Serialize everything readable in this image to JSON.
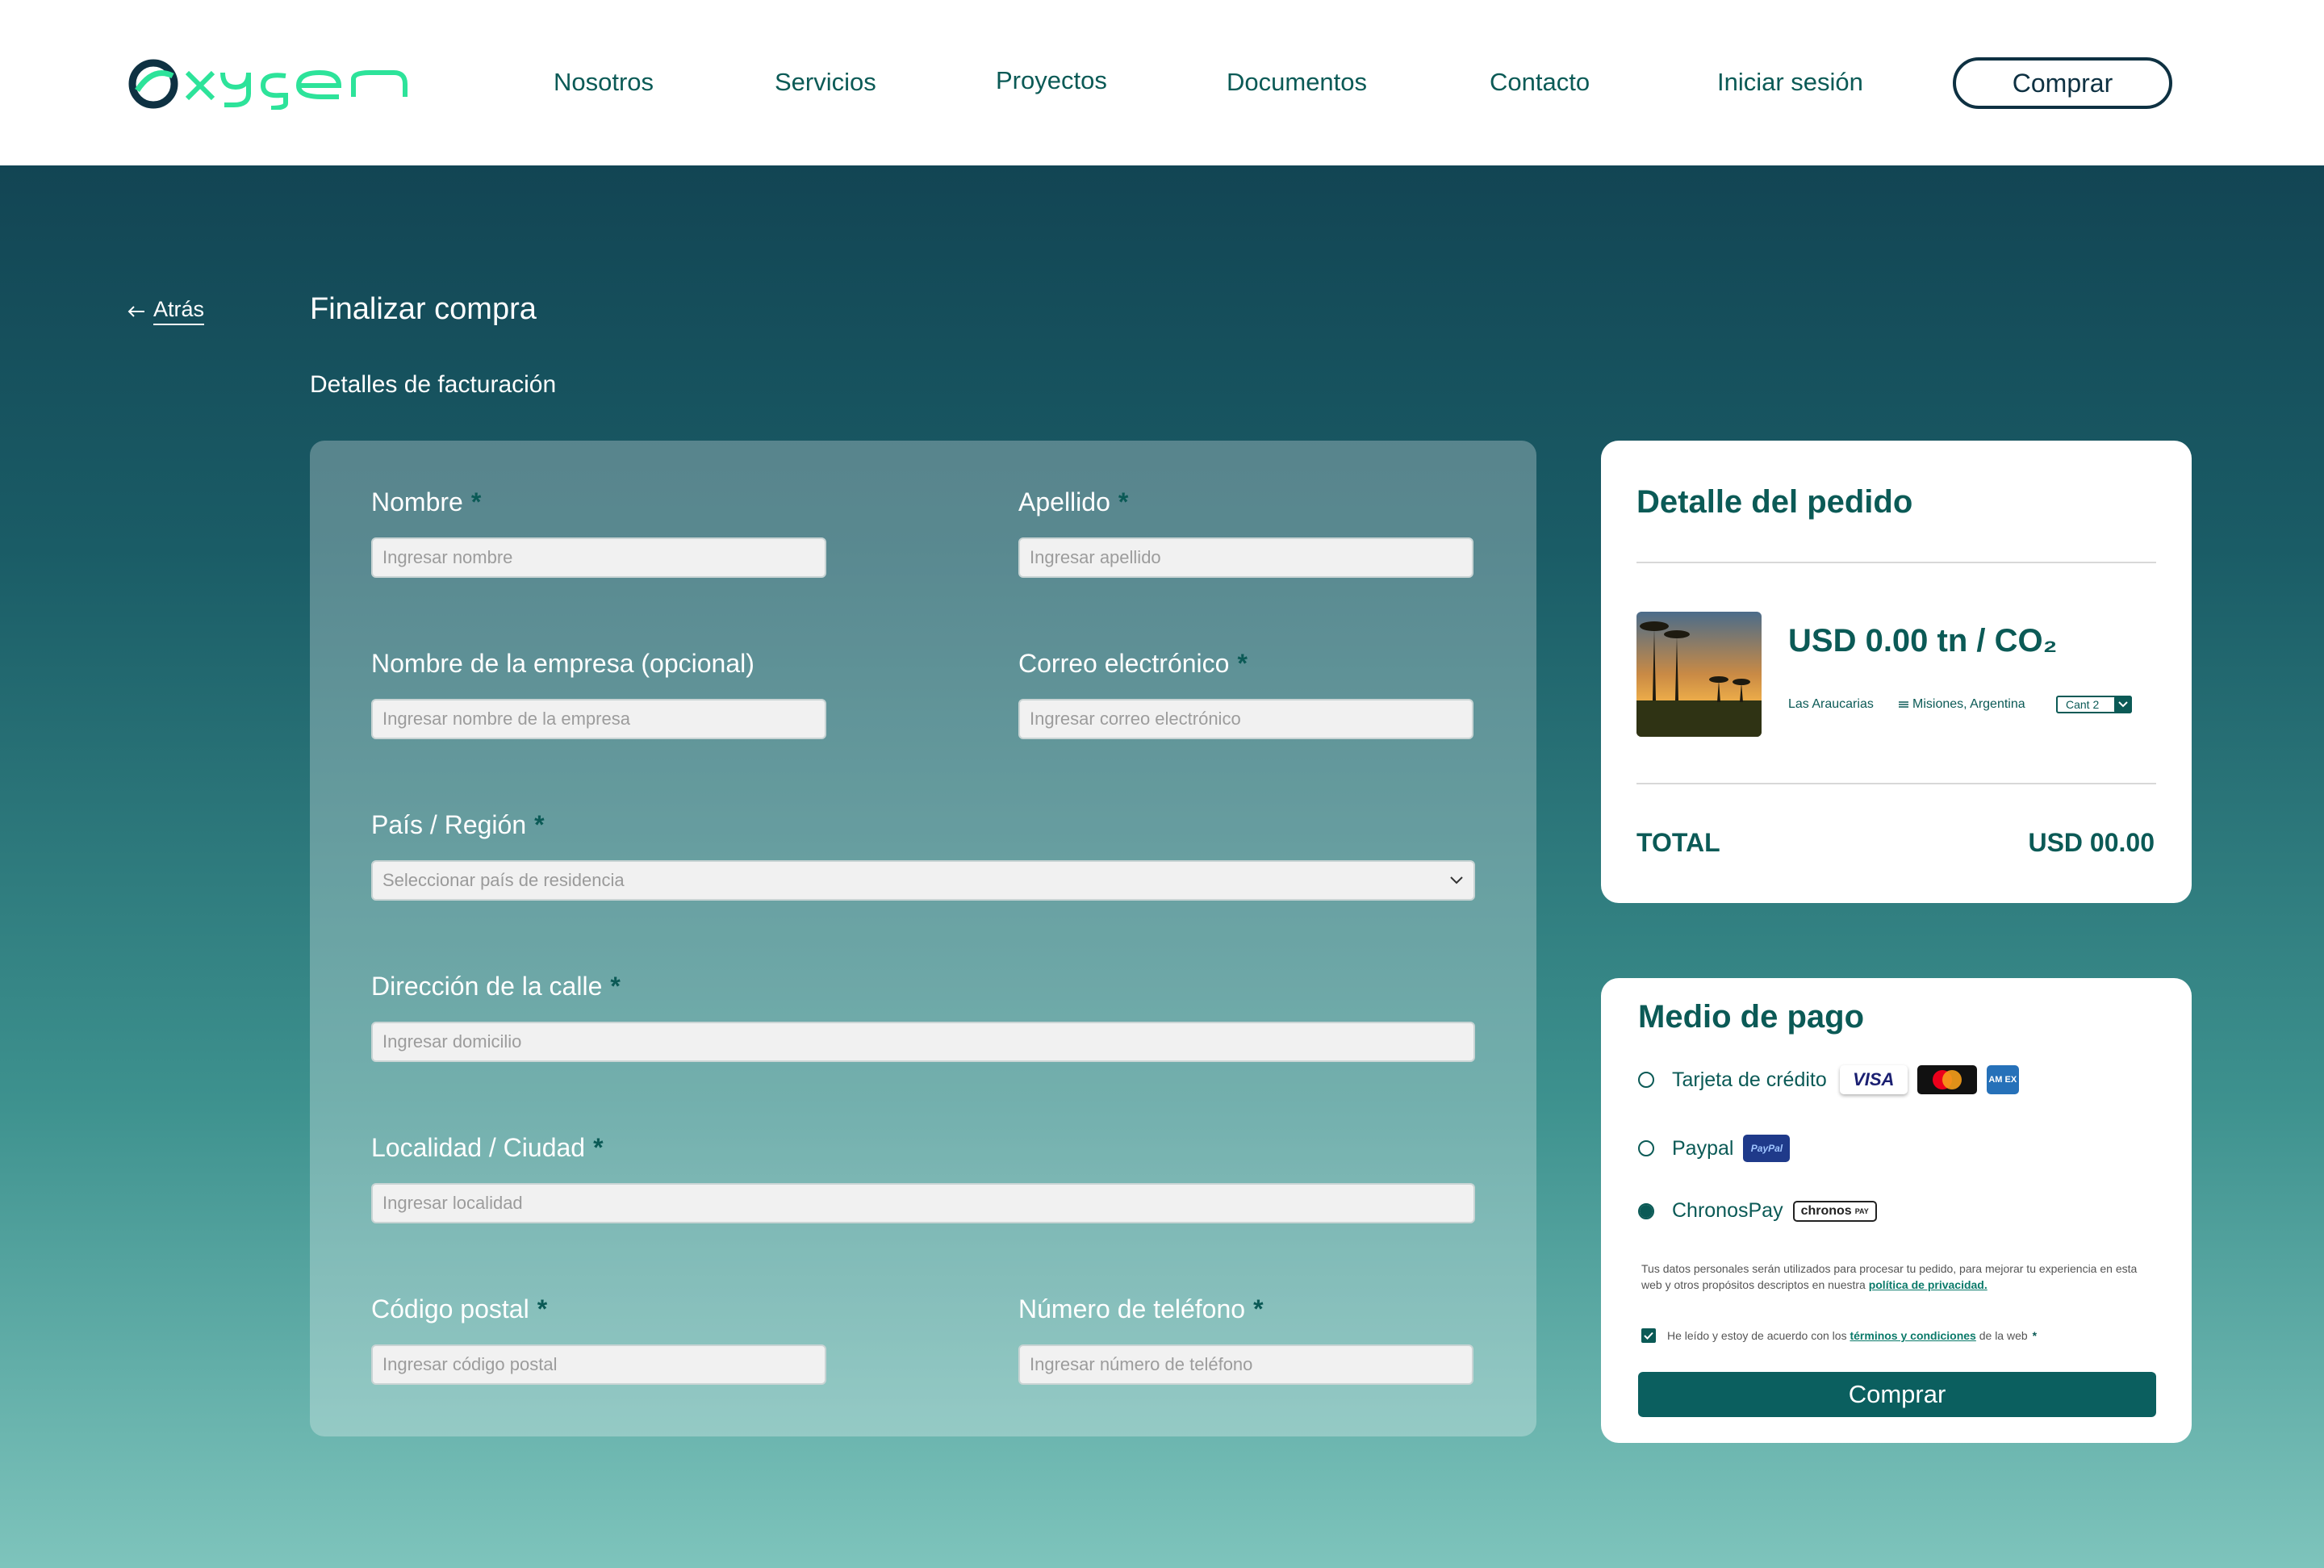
{
  "header": {
    "nav": [
      "Nosotros",
      "Servicios",
      "Proyectos",
      "Documentos",
      "Contacto",
      "Iniciar sesión"
    ],
    "buy_label": "Comprar"
  },
  "page": {
    "back_label": "Atrás",
    "title": "Finalizar compra",
    "section": "Detalles de facturación"
  },
  "form": {
    "nombre": {
      "label": "Nombre",
      "placeholder": "Ingresar nombre"
    },
    "apellido": {
      "label": "Apellido",
      "placeholder": "Ingresar apellido"
    },
    "empresa": {
      "label": "Nombre de la empresa (opcional)",
      "placeholder": "Ingresar nombre de la empresa"
    },
    "correo": {
      "label": "Correo electrónico",
      "placeholder": "Ingresar correo electrónico"
    },
    "pais": {
      "label": "País / Región",
      "placeholder": "Seleccionar país de residencia"
    },
    "direccion": {
      "label": "Dirección de la calle",
      "placeholder": "Ingresar domicilio"
    },
    "localidad": {
      "label": "Localidad / Ciudad",
      "placeholder": "Ingresar localidad"
    },
    "postal": {
      "label": "Código postal",
      "placeholder": "Ingresar código postal"
    },
    "telefono": {
      "label": "Número de teléfono",
      "placeholder": "Ingresar número de teléfono"
    },
    "required_mark": "*"
  },
  "order": {
    "title": "Detalle del pedido",
    "price": "USD 0.00 tn / CO₂",
    "project": "Las Araucarias",
    "location": "Misiones, Argentina",
    "qty": "Cant 2",
    "total_label": "TOTAL",
    "total_value": "USD 00.00"
  },
  "payment": {
    "title": "Medio de pago",
    "options": [
      "Tarjeta de crédito",
      "Paypal",
      "ChronosPay"
    ],
    "selected": "ChronosPay",
    "visa": "VISA",
    "amex": "AM EX",
    "paypal_badge": "PayPal",
    "chronos_badge": "chronos",
    "chronos_pay": "PAY",
    "privacy_text": "Tus datos personales serán utilizados para procesar tu pedido, para mejorar tu experiencia en esta web y otros propósitos descriptos en nuestra",
    "privacy_link": "política de privacidad.",
    "terms_before": "He leído y estoy de acuerdo con los",
    "terms_link": "términos y condiciones",
    "terms_after": "de la web",
    "terms_req": "*",
    "buy_label": "Comprar"
  },
  "colors": {
    "brand": "#0b5a56",
    "accent": "#2de39a",
    "header_dark": "#0e3142"
  }
}
